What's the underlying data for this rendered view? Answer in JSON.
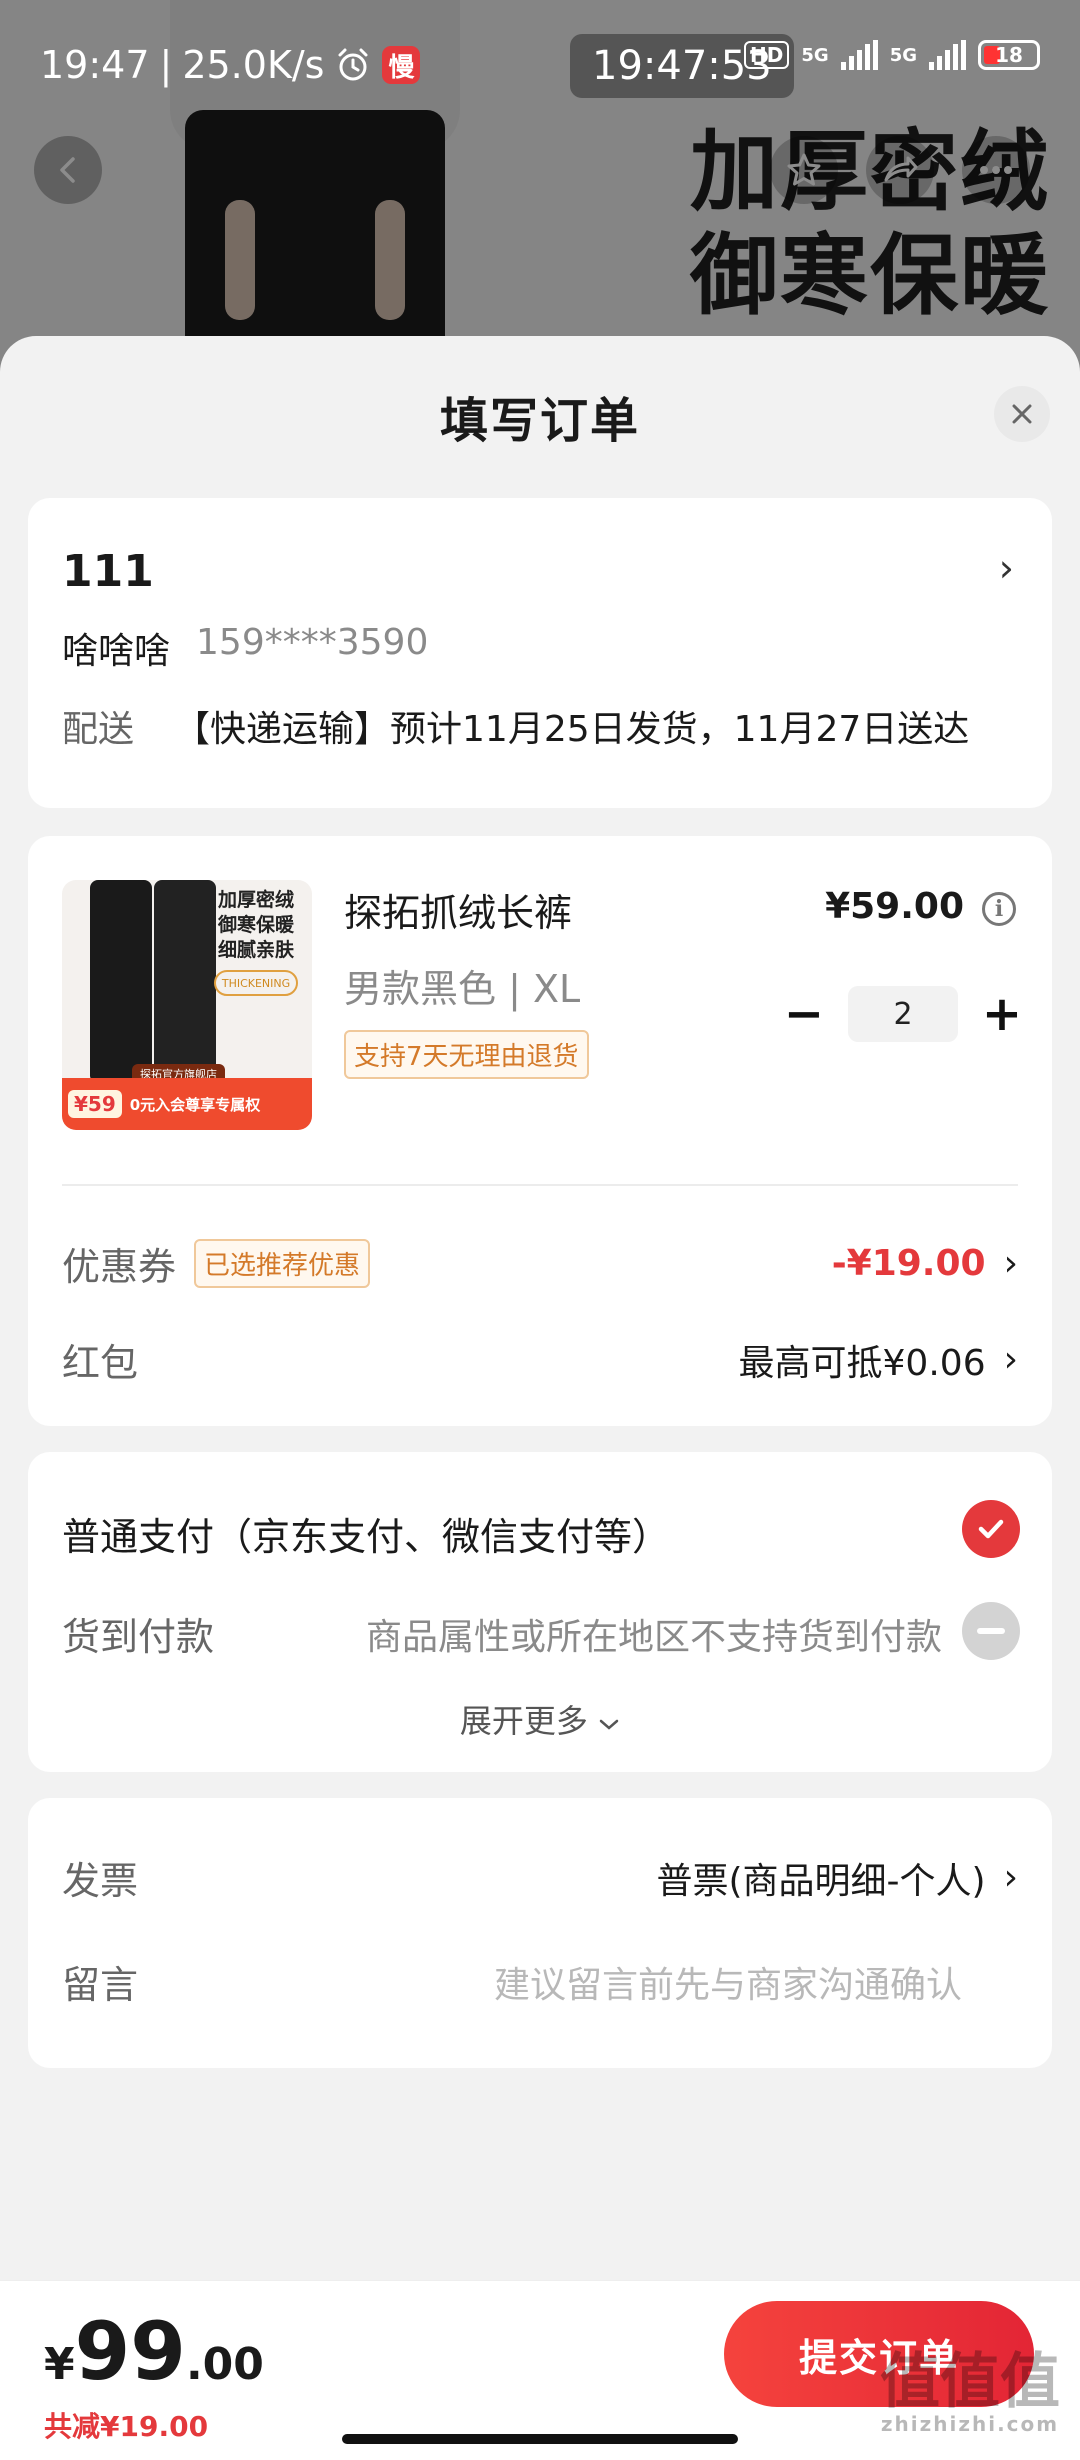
{
  "status_bar": {
    "time": "19:47",
    "speed": "25.0K/s",
    "app_badge": "慢",
    "clock_pill": "19:47:53",
    "hd": "HD",
    "network_1": "5G",
    "network_2": "5G",
    "battery": "18"
  },
  "background": {
    "slogan_line1": "加厚密绒",
    "slogan_line2": "御寒保暖"
  },
  "sheet": {
    "title": "填写订单"
  },
  "address": {
    "name": "111",
    "contact_name": "啥啥啥",
    "phone": "159****3590",
    "ship_label": "配送",
    "ship_info": "【快递运输】预计11月25日发货，11月27日送达"
  },
  "product": {
    "image_lines": [
      "加厚密绒",
      "御寒保暖",
      "细腻亲肤"
    ],
    "image_tag": "THICKENING",
    "image_shop": "探拓官方旗舰店",
    "image_price": "¥59",
    "image_promo": "0元入会尊享专属权",
    "title": "探拓抓绒长裤",
    "spec": "男款黑色 | XL",
    "return_policy": "支持7天无理由退货",
    "price": "¥59.00",
    "quantity": "2",
    "minus": "−",
    "plus": "+"
  },
  "coupon": {
    "label": "优惠券",
    "tag": "已选推荐优惠",
    "value": "-¥19.00"
  },
  "redpacket": {
    "label": "红包",
    "value": "最高可抵¥0.06"
  },
  "payment": {
    "main": "普通支付（京东支付、微信支付等）",
    "cod_label": "货到付款",
    "cod_note": "商品属性或所在地区不支持货到付款",
    "expand": "展开更多"
  },
  "invoice": {
    "label": "发票",
    "value": "普票(商品明细-个人)"
  },
  "message": {
    "label": "留言",
    "placeholder": "建议留言前先与商家沟通确认"
  },
  "bottom": {
    "currency": "¥",
    "total_int": "99",
    "total_dec": ".00",
    "saved": "共减¥19.00",
    "submit": "提交订单"
  },
  "watermark": {
    "logo": "值值值",
    "site": "zhizhizhi.com"
  },
  "colors": {
    "accent": "#e4393c",
    "tag_orange": "#d47a2a"
  }
}
